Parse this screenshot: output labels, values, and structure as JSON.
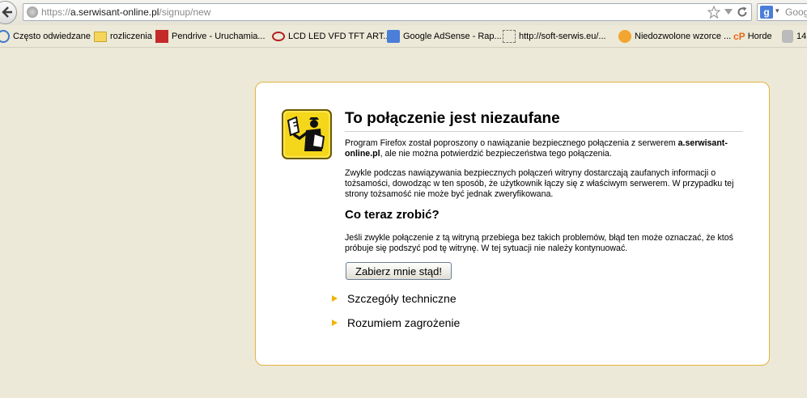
{
  "navbar": {
    "url_prefix": "https://",
    "url_host": "a.serwisant-online.pl",
    "url_path": "/signup/new",
    "search_placeholder": "Googl"
  },
  "bookmarks": [
    {
      "label": "Często odwiedzane",
      "icon": "frequent-sites-icon"
    },
    {
      "label": "rozliczenia",
      "icon": "folder-icon"
    },
    {
      "label": "Pendrive - Uruchamia...",
      "icon": "pc-world-icon"
    },
    {
      "label": "LCD LED VFD TFT ART...",
      "icon": "red-eye-icon"
    },
    {
      "label": "Google AdSense - Rap...",
      "icon": "google-icon"
    },
    {
      "label": "http://soft-serwis.eu/...",
      "icon": "blank-page-icon"
    },
    {
      "label": "Niedozwolone wzorce ...",
      "icon": "orange-circle-icon"
    },
    {
      "label": "Horde",
      "icon": "cpanel-icon"
    },
    {
      "label": "14",
      "icon": "tool-icon"
    }
  ],
  "error": {
    "title": "To połączenie jest niezaufane",
    "para1_before": "Program Firefox został poproszony o nawiązanie bezpiecznego połączenia z serwerem ",
    "para1_host": "a.serwisant-online.pl",
    "para1_after": ", ale nie można potwierdzić bezpieczeństwa tego połączenia.",
    "para2": "Zwykle podczas nawiązywania bezpiecznych połączeń witryny dostarczają zaufanych informacji o tożsamości, dowodząc w ten sposób, że użytkownik łączy się z właściwym serwerem. W przypadku tej strony tożsamość nie może być jednak zweryfikowana.",
    "subtitle": "Co teraz zrobić?",
    "para3": "Jeśli zwykle połączenie z tą witryną przebiega bez takich problemów, błąd ten może oznaczać, że ktoś próbuje się podszyć pod tę witrynę. W tej sytuacji nie należy kontynuować.",
    "button_label": "Zabierz mnie stąd!",
    "tech_details_label": "Szczegóły techniczne",
    "understand_risks_label": "Rozumiem zagrożenie",
    "accent_color": "#f0b400",
    "border_color": "#e3b341"
  }
}
